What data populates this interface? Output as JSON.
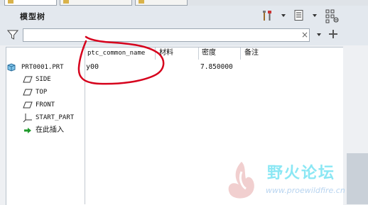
{
  "panel": {
    "title": "模型树"
  },
  "search": {
    "value": "",
    "clear_glyph": "×"
  },
  "toolbar": {
    "icons": [
      "settings-icon",
      "show-icon",
      "tree-filter-icon"
    ]
  },
  "columns": [
    {
      "label": "ptc_common_name"
    },
    {
      "label": "材料"
    },
    {
      "label": "密度"
    },
    {
      "label": "备注"
    }
  ],
  "tree": {
    "root": {
      "label": "PRT0001.PRT",
      "common_name": "y00",
      "density": "7.850000"
    },
    "items": [
      {
        "label": "SIDE",
        "icon": "datum-plane-icon"
      },
      {
        "label": "TOP",
        "icon": "datum-plane-icon"
      },
      {
        "label": "FRONT",
        "icon": "datum-plane-icon"
      },
      {
        "label": "START_PART",
        "icon": "coordinate-system-icon"
      },
      {
        "label": "在此插入",
        "icon": "insert-here-icon"
      }
    ]
  },
  "watermark": {
    "text": "野火论坛",
    "url": "www.proewildfire.cn"
  },
  "colors": {
    "annotation": "#d6001c",
    "watermark": "#7fe5f3"
  }
}
